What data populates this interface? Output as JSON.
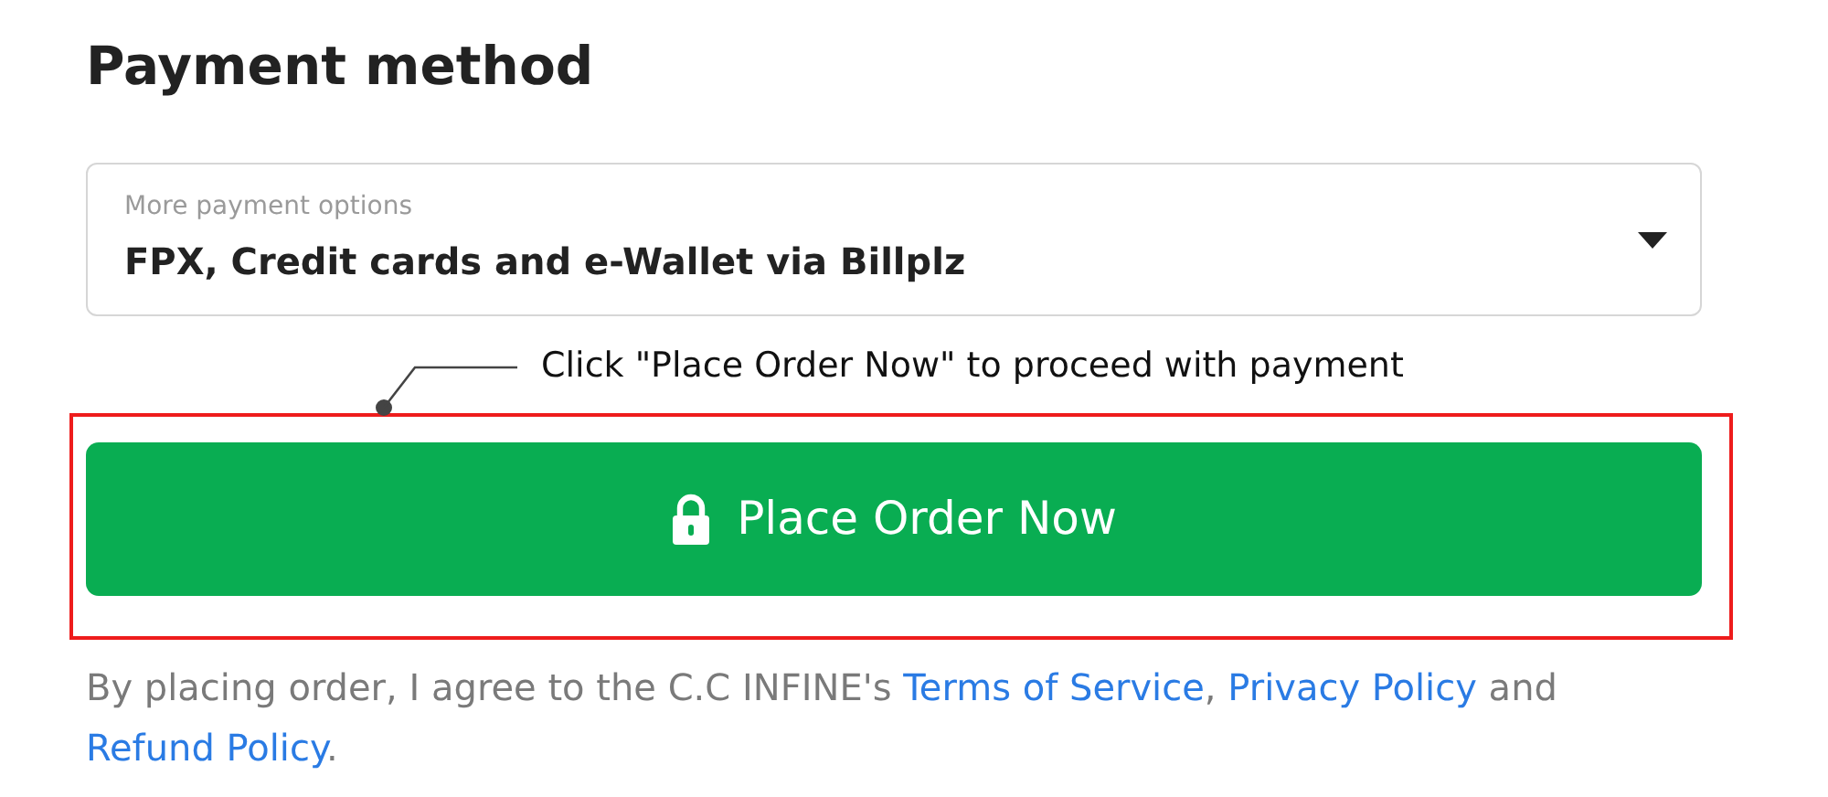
{
  "title": "Payment method",
  "payment_select": {
    "label": "More payment options",
    "value": "FPX, Credit cards and e-Wallet via Billplz"
  },
  "callout": "Click \"Place Order Now\" to proceed with payment",
  "order_button": {
    "label": "Place Order Now"
  },
  "terms": [
    {
      "kind": "text",
      "text": "By placing order, I agree to the C.C INFINE's "
    },
    {
      "kind": "link",
      "text": "Terms of Service"
    },
    {
      "kind": "text",
      "text": ", "
    },
    {
      "kind": "link",
      "text": "Privacy Policy"
    },
    {
      "kind": "text",
      "text": " and "
    },
    {
      "kind": "link",
      "text": "Refund Policy"
    },
    {
      "kind": "text",
      "text": "."
    }
  ]
}
